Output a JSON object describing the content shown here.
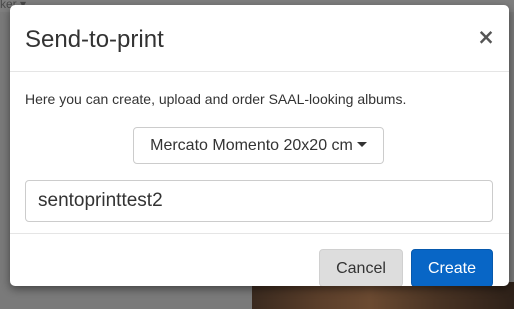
{
  "backdrop": {
    "partial_text": "ker ▾"
  },
  "dialog": {
    "title": "Send-to-print",
    "close_label": "×",
    "description": "Here you can create, upload and order SAAL-looking albums.",
    "product_select": {
      "selected": "Mercato Momento 20x20 cm"
    },
    "name_input": {
      "value": "sentoprinttest2"
    },
    "buttons": {
      "cancel": "Cancel",
      "create": "Create"
    }
  },
  "colors": {
    "primary": "#0866c6",
    "secondary": "#dddddd",
    "overlay": "#7a7a7a"
  }
}
